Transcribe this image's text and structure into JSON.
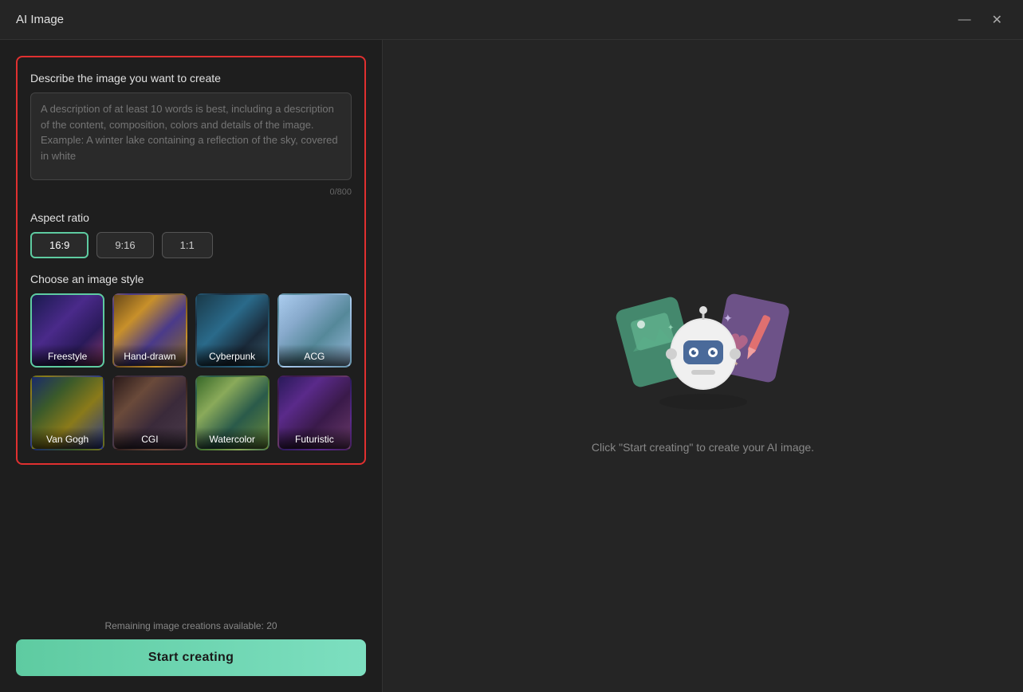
{
  "titleBar": {
    "title": "AI Image",
    "minimizeBtn": "—",
    "closeBtn": "✕"
  },
  "leftPanel": {
    "describeLabel": "Describe the image you want to create",
    "textareaPlaceholder": "A description of at least 10 words is best, including a description of the content, composition, colors and details of the image. Example: A winter lake containing a reflection of the sky, covered in white",
    "charCount": "0/800",
    "aspectRatioLabel": "Aspect ratio",
    "aspectOptions": [
      {
        "value": "16:9",
        "active": true
      },
      {
        "value": "9:16",
        "active": false
      },
      {
        "value": "1:1",
        "active": false
      }
    ],
    "styleLabel": "Choose an image style",
    "styles": [
      {
        "id": "freestyle",
        "label": "Freestyle",
        "selected": true
      },
      {
        "id": "handdrawn",
        "label": "Hand-drawn",
        "selected": false
      },
      {
        "id": "cyberpunk",
        "label": "Cyberpunk",
        "selected": false
      },
      {
        "id": "acg",
        "label": "ACG",
        "selected": false
      },
      {
        "id": "vangogh",
        "label": "Van Gogh",
        "selected": false
      },
      {
        "id": "cgi",
        "label": "CGI",
        "selected": false
      },
      {
        "id": "watercolor",
        "label": "Watercolor",
        "selected": false
      },
      {
        "id": "futuristic",
        "label": "Futuristic",
        "selected": false
      }
    ],
    "remainingText": "Remaining image creations available: 20",
    "startBtn": "Start creating"
  },
  "rightPanel": {
    "hintText": "Click \"Start creating\" to create your AI image."
  }
}
